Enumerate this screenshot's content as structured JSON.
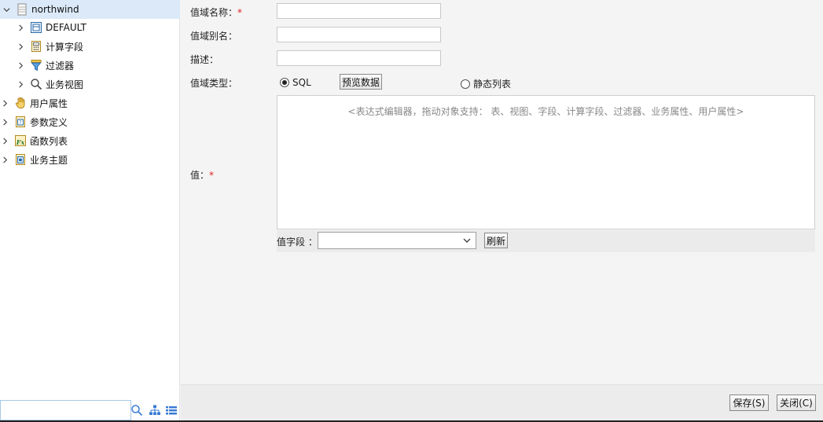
{
  "tree": {
    "root": {
      "label": "northwind",
      "icon": "database-icon"
    },
    "items": [
      {
        "label": "DEFAULT",
        "icon": "schema-icon"
      },
      {
        "label": "计算字段",
        "icon": "calculated-field-icon"
      },
      {
        "label": "过滤器",
        "icon": "filter-icon"
      },
      {
        "label": "业务视图",
        "icon": "magnifier-icon"
      }
    ],
    "top_items": [
      {
        "label": "用户属性",
        "icon": "hand-icon"
      },
      {
        "label": "参数定义",
        "icon": "parameter-icon"
      },
      {
        "label": "函数列表",
        "icon": "function-icon"
      },
      {
        "label": "业务主题",
        "icon": "business-theme-icon"
      }
    ]
  },
  "left_bottom": {
    "search_value": "",
    "icons": [
      "search-icon",
      "tree-view-icon",
      "list-view-icon"
    ]
  },
  "form": {
    "name_label": "值域名称：",
    "name_required": "*",
    "name_value": "",
    "alias_label": "值域别名：",
    "alias_value": "",
    "desc_label": "描述：",
    "desc_value": "",
    "type_label": "值域类型：",
    "type_sql": "SQL",
    "preview_button": "预览数据",
    "type_static": "静态列表",
    "value_label": "值：",
    "value_required": "*",
    "editor_placeholder": "<表达式编辑器，拖动对象支持： 表、视图、字段、计算字段、过滤器、业务属性、用户属性>",
    "value_field_label": "值字段 ：",
    "value_field_selected": "",
    "refresh_button": "刷新"
  },
  "footer": {
    "save_button": "保存(S)",
    "close_button": "关闭(C)"
  },
  "colors": {
    "selected_row": "#dbe9f8",
    "required": "#e02020",
    "search_border": "#a8c8e6"
  }
}
